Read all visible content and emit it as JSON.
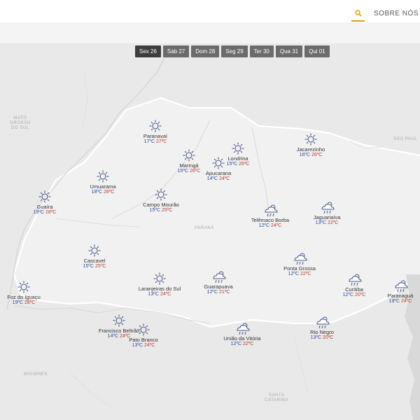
{
  "header": {
    "about_label": "SOBRE NÓS"
  },
  "day_tabs": [
    "Sex 26",
    "Sáb 27",
    "Dom 28",
    "Seg 29",
    "Ter 30",
    "Qua 31",
    "Qui 01"
  ],
  "map_labels": {
    "mato_grosso": "MATO\nGROSSO\nDO SUL",
    "sao_paulo": "SÃO PAUL",
    "parana": "PARANÁ",
    "misiones": "MISIONES",
    "santa_catarina": "SANTA\nCATARINA"
  },
  "cities": [
    {
      "name": "Paranavaí",
      "min": "17ºC",
      "max": "27ºC",
      "weather": "sun-icon"
    },
    {
      "name": "Maringá",
      "min": "15ºC",
      "max": "26ºC",
      "weather": "sun-icon"
    },
    {
      "name": "Londrina",
      "min": "15ºC",
      "max": "26ºC",
      "weather": "sun-icon"
    },
    {
      "name": "Apucarana",
      "min": "14ºC",
      "max": "24ºC",
      "weather": "sun-icon"
    },
    {
      "name": "Jacarezinho",
      "min": "16ºC",
      "max": "26ºC",
      "weather": "sun-icon"
    },
    {
      "name": "Umuarama",
      "min": "18ºC",
      "max": "28ºC",
      "weather": "sun-icon"
    },
    {
      "name": "Guaíra",
      "min": "19ºC",
      "max": "28ºC",
      "weather": "sun-icon"
    },
    {
      "name": "Campo Mourão",
      "min": "15ºC",
      "max": "25ºC",
      "weather": "sun-icon"
    },
    {
      "name": "Telêmaco Borba",
      "min": "12ºC",
      "max": "24ºC",
      "weather": "cloud-rain-icon"
    },
    {
      "name": "Jaguariaíva",
      "min": "13ºC",
      "max": "22ºC",
      "weather": "cloud-rain-icon"
    },
    {
      "name": "Cascavel",
      "min": "15ºC",
      "max": "25ºC",
      "weather": "sun-icon"
    },
    {
      "name": "Ponta Grossa",
      "min": "12ºC",
      "max": "22ºC",
      "weather": "cloud-rain-icon"
    },
    {
      "name": "Foz do Iguaçu",
      "min": "19ºC",
      "max": "28ºC",
      "weather": "sun-icon"
    },
    {
      "name": "Laranjeiras do Sul",
      "min": "13ºC",
      "max": "24ºC",
      "weather": "sun-icon"
    },
    {
      "name": "Guarapuava",
      "min": "12ºC",
      "max": "21ºC",
      "weather": "cloud-rain-icon"
    },
    {
      "name": "Curitiba",
      "min": "12ºC",
      "max": "20ºC",
      "weather": "cloud-rain-icon"
    },
    {
      "name": "Paranaguá",
      "min": "19ºC",
      "max": "24ºC",
      "weather": "cloud-rain-icon"
    },
    {
      "name": "Francisco Beltrão",
      "min": "14ºC",
      "max": "24ºC",
      "weather": "sun-icon"
    },
    {
      "name": "Pato Branco",
      "min": "13ºC",
      "max": "24ºC",
      "weather": "sun-icon"
    },
    {
      "name": "União da Vitória",
      "min": "12ºC",
      "max": "22ºC",
      "weather": "cloud-rain-icon"
    },
    {
      "name": "Rio Negro",
      "min": "13ºC",
      "max": "20ºC",
      "weather": "cloud-rain-icon"
    }
  ],
  "colors": {
    "accent": "#e0a100",
    "temp_min": "#2a4fa0",
    "temp_max": "#c0392b",
    "icon": "#4a5a8a"
  }
}
